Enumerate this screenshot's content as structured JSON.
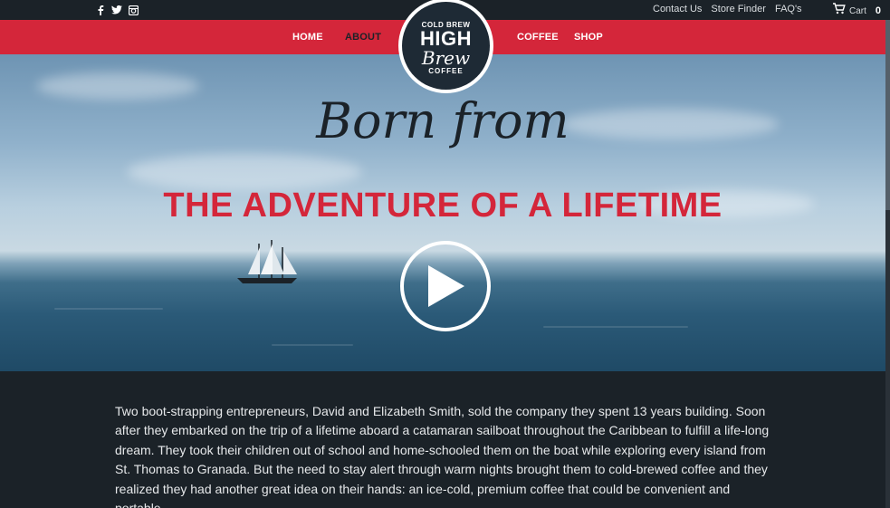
{
  "social": {
    "items": [
      {
        "name": "facebook-icon",
        "glyph": "f"
      },
      {
        "name": "twitter-icon",
        "glyph": "t"
      },
      {
        "name": "instagram-icon",
        "glyph": "i"
      }
    ]
  },
  "utility_links": [
    "Contact Us",
    "Store Finder",
    "FAQ's"
  ],
  "cart": {
    "label": "Cart",
    "count": "0"
  },
  "nav": {
    "home": "HOME",
    "about": "ABOUT",
    "coffee": "COFFEE",
    "shop": "SHOP",
    "active": "ABOUT"
  },
  "logo": {
    "top": "COLD BREW",
    "high": "HIGH",
    "brew": "Brew",
    "bottom": "COFFEE"
  },
  "hero": {
    "script_text": "Born from",
    "headline": "THE ADVENTURE OF A LIFETIME"
  },
  "story": "Two boot-strapping entrepreneurs, David and Elizabeth Smith, sold the company they spent 13 years building. Soon after they embarked on the trip of a lifetime aboard a catamaran sailboat throughout the Caribbean to fulfill a life-long dream. They took their children out of school and home-schooled them on the boat while exploring every island from St. Thomas to Granada. But the need to stay alert through warm nights brought them to cold-brewed coffee and they realized they had another great idea on their hands: an ice-cold, premium coffee that could be convenient and portable.",
  "colors": {
    "brand_red": "#d4263a",
    "dark": "#1b2228"
  }
}
